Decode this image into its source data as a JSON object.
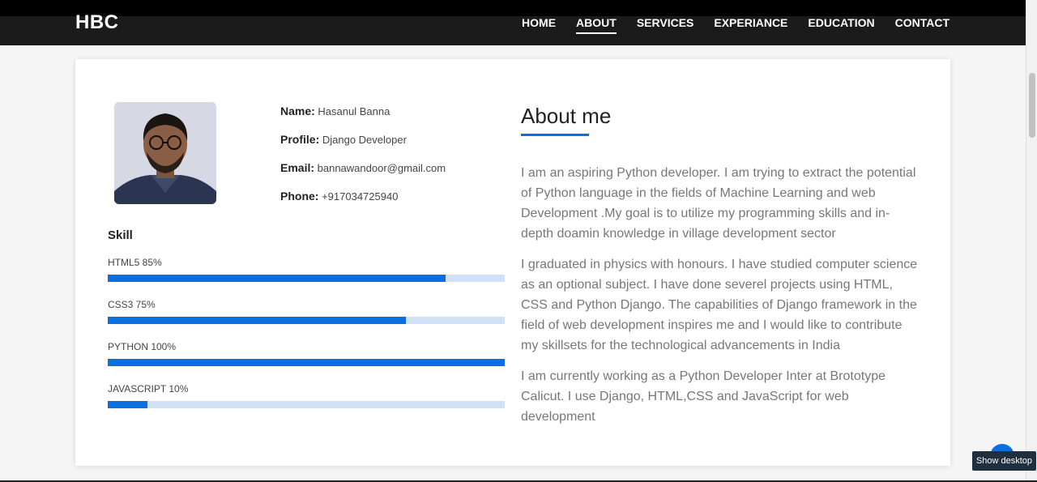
{
  "brand": "HBC",
  "nav": [
    {
      "label": "HOME",
      "active": false
    },
    {
      "label": "ABOUT",
      "active": true
    },
    {
      "label": "SERVICES",
      "active": false
    },
    {
      "label": "EXPERIANCE",
      "active": false
    },
    {
      "label": "EDUCATION",
      "active": false
    },
    {
      "label": "CONTACT",
      "active": false
    }
  ],
  "profile": {
    "name_key": "Name:",
    "name": "Hasanul Banna",
    "profile_key": "Profile:",
    "profile": "Django Developer",
    "email_key": "Email:",
    "email": "bannawandoor@gmail.com",
    "phone_key": "Phone:",
    "phone": "+917034725940"
  },
  "skill_title": "Skill",
  "skills": [
    {
      "label": "HTML5 85%",
      "percent": 85
    },
    {
      "label": "CSS3 75%",
      "percent": 75
    },
    {
      "label": "PYTHON 100%",
      "percent": 100
    },
    {
      "label": "JAVASCRIPT 10%",
      "percent": 10
    }
  ],
  "about": {
    "title": "About me",
    "paragraphs": [
      "I am an aspiring Python developer. I am trying to extract the potential of Python language in the fields of Machine Learning and web Development .My goal is to utilize my programming skills and in-depth doamin knowledge in village development sector",
      "I graduated in physics with honours. I have studied computer science as an optional subject. I have done severel projects using HTML, CSS and Python Django. The capabilities of Django framework in the field of web development inspires me and I would like to contribute my skillsets for the technological advancements in India",
      "I am currently working as a Python Developer Inter at Brototype Calicut. I use Django, HTML,CSS and JavaScript for web development"
    ]
  },
  "tooltip": "Show desktop",
  "colors": {
    "accent": "#0b6fe0",
    "bar_bg": "#cfe0f7",
    "header": "#1b1b1b"
  }
}
